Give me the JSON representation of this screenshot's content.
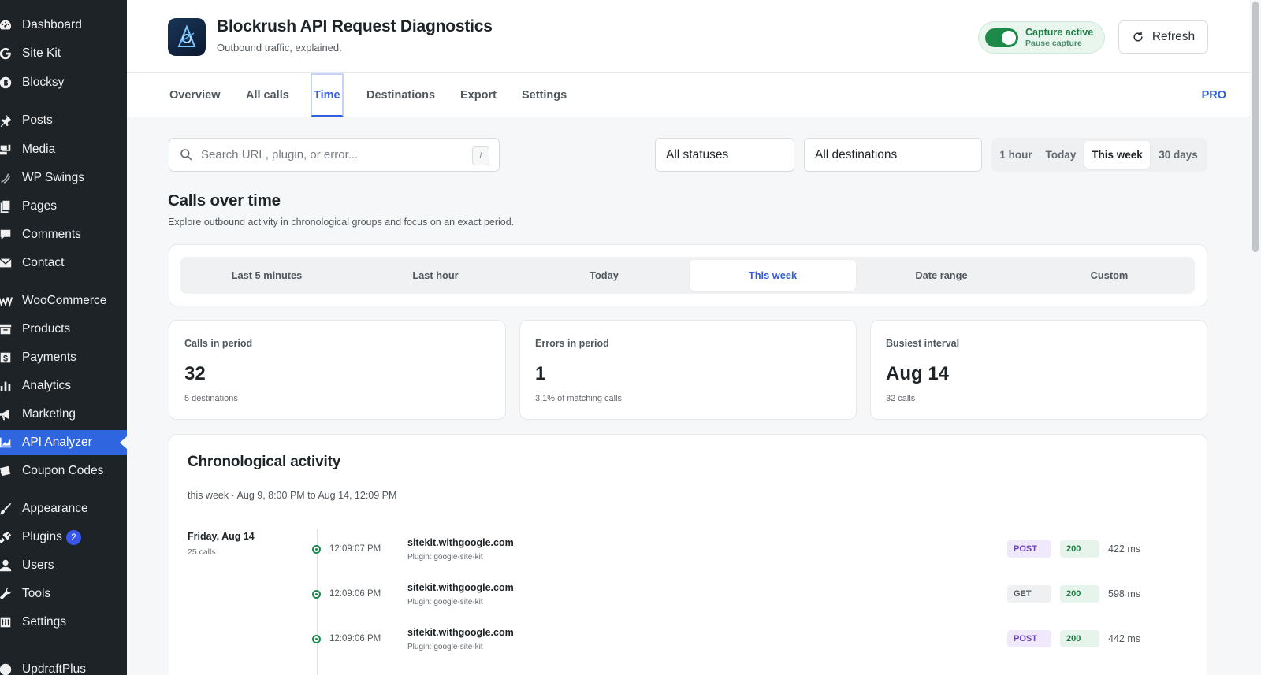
{
  "sidebar": {
    "items": [
      {
        "label": "Dashboard",
        "icon": "dashboard-icon"
      },
      {
        "label": "Site Kit",
        "icon": "google-icon"
      },
      {
        "label": "Blocksy",
        "icon": "blocksy-icon"
      },
      {
        "label": "Posts",
        "icon": "pin-icon"
      },
      {
        "label": "Media",
        "icon": "media-icon"
      },
      {
        "label": "WP Swings",
        "icon": "swings-icon"
      },
      {
        "label": "Pages",
        "icon": "pages-icon"
      },
      {
        "label": "Comments",
        "icon": "comments-icon"
      },
      {
        "label": "Contact",
        "icon": "mail-icon"
      },
      {
        "label": "WooCommerce",
        "icon": "woo-icon"
      },
      {
        "label": "Products",
        "icon": "archive-icon"
      },
      {
        "label": "Payments",
        "icon": "dollar-icon"
      },
      {
        "label": "Analytics",
        "icon": "bar-chart-icon"
      },
      {
        "label": "Marketing",
        "icon": "megaphone-icon"
      },
      {
        "label": "API Analyzer",
        "icon": "chart-area-icon",
        "active": true
      },
      {
        "label": "Coupon Codes",
        "icon": "coupon-icon"
      },
      {
        "label": "Appearance",
        "icon": "brush-icon"
      },
      {
        "label": "Plugins",
        "icon": "plug-icon",
        "badge": "2"
      },
      {
        "label": "Users",
        "icon": "user-icon"
      },
      {
        "label": "Tools",
        "icon": "wrench-icon"
      },
      {
        "label": "Settings",
        "icon": "settings-icon"
      },
      {
        "label": "UpdraftPlus",
        "icon": "updraft-icon"
      }
    ]
  },
  "header": {
    "title": "Blockrush API Request Diagnostics",
    "subtitle": "Outbound traffic, explained.",
    "capture_title": "Capture active",
    "capture_sub": "Pause capture",
    "refresh_label": "Refresh"
  },
  "tabs": {
    "items": [
      "Overview",
      "All calls",
      "Time",
      "Destinations",
      "Export",
      "Settings"
    ],
    "active": "Time",
    "pro_label": "PRO"
  },
  "filters": {
    "search_placeholder": "Search URL, plugin, or error...",
    "shortcut": "/",
    "status_value": "All statuses",
    "destination_value": "All destinations",
    "ranges": [
      "1 hour",
      "Today",
      "This week",
      "30 days"
    ],
    "active_range": "This week"
  },
  "section": {
    "title": "Calls over time",
    "description": "Explore outbound activity in chronological groups and focus on an exact period."
  },
  "period": {
    "options": [
      "Last 5 minutes",
      "Last hour",
      "Today",
      "This week",
      "Date range",
      "Custom"
    ],
    "active": "This week"
  },
  "stats": [
    {
      "label": "Calls in period",
      "value": "32",
      "sub": "5 destinations"
    },
    {
      "label": "Errors in period",
      "value": "1",
      "sub": "3.1% of matching calls"
    },
    {
      "label": "Busiest interval",
      "value": "Aug 14",
      "sub": "32 calls"
    }
  ],
  "activity": {
    "title": "Chronological activity",
    "range_text": "this week · Aug 9, 8:00 PM to Aug 14, 12:09 PM",
    "day": {
      "label": "Friday, Aug 14",
      "count": "25 calls"
    },
    "rows": [
      {
        "time": "12:09:07 PM",
        "host": "sitekit.withgoogle.com",
        "plugin": "Plugin: google-site-kit",
        "method": "POST",
        "status": "200",
        "duration": "422 ms"
      },
      {
        "time": "12:09:06 PM",
        "host": "sitekit.withgoogle.com",
        "plugin": "Plugin: google-site-kit",
        "method": "GET",
        "status": "200",
        "duration": "598 ms"
      },
      {
        "time": "12:09:06 PM",
        "host": "sitekit.withgoogle.com",
        "plugin": "Plugin: google-site-kit",
        "method": "POST",
        "status": "200",
        "duration": "442 ms"
      }
    ]
  },
  "colors": {
    "accent": "#2f5fe0",
    "sidebar_bg": "#1d2327",
    "sidebar_active": "#2f66e0",
    "success": "#1e8a4a"
  }
}
